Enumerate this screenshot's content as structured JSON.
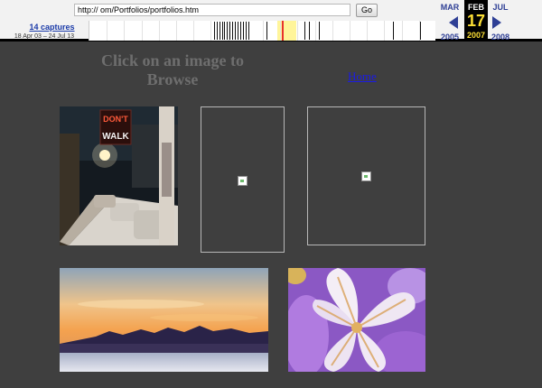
{
  "wayback": {
    "url_value": "http://                                om/Portfolios/portfolios.htm",
    "go_label": "Go",
    "captures_label": "14 captures",
    "date_range": "18 Apr 03 – 24 Jul 13",
    "prev": {
      "month": "MAR",
      "year": "2005"
    },
    "current": {
      "month": "FEB",
      "day": "17",
      "year": "2007"
    },
    "next": {
      "month": "JUL",
      "year": "2008"
    }
  },
  "page": {
    "heading": "Click on an image to Browse",
    "home_link": "Home"
  },
  "thumbnails": [
    {
      "subject": "dont-walk-street-night-photo",
      "loaded": true
    },
    {
      "subject": "broken-image",
      "loaded": false
    },
    {
      "subject": "broken-image",
      "loaded": false
    },
    {
      "subject": "mountain-sunset-lake-photo",
      "loaded": true
    },
    {
      "subject": "purple-iris-flower-photo",
      "loaded": true
    }
  ],
  "photo_text": {
    "sign_line1": "DON'T",
    "sign_line2": "WALK"
  },
  "colors": {
    "background": "#3f3f3f",
    "heading": "#6e6e6e",
    "link": "#1a1ae6",
    "wayback_blue": "#2e3f95",
    "wayback_yellow": "#fcdf35"
  }
}
